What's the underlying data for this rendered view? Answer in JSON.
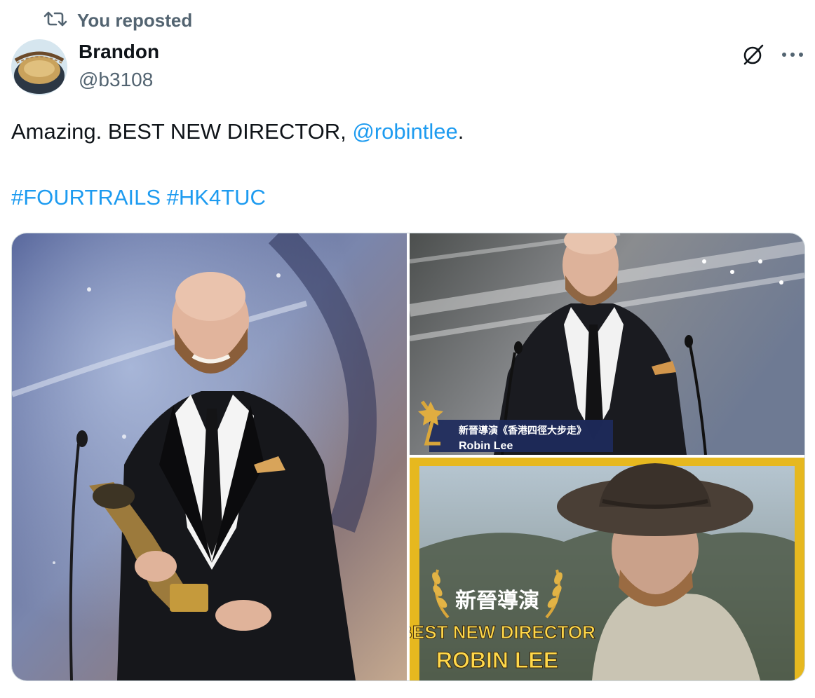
{
  "repost": {
    "label": "You reposted",
    "icon": "repost-icon"
  },
  "author": {
    "name": "Brandon",
    "handle": "@b3108",
    "avatar_icon": "avatar"
  },
  "actions": {
    "grok_icon": "grok-icon",
    "more_icon": "more-icon"
  },
  "tweet": {
    "text_prefix": "Amazing. BEST NEW DIRECTOR, ",
    "mention": "@robintlee",
    "text_suffix": ".",
    "hashtag_1": "#FOURTRAILS",
    "hashtag_2": "#HK4TUC"
  },
  "media": {
    "image2_caption_cn": "新晉導演《香港四徑大步走》",
    "image2_caption_name": "Robin Lee",
    "image3_award_cn": "新晉導演",
    "image3_award_en": "BEST NEW DIRECTOR",
    "image3_name": "ROBIN LEE"
  },
  "colors": {
    "link": "#1d9bf0",
    "secondary_text": "#536471",
    "text": "#0f1419",
    "border": "#cfd9de"
  }
}
